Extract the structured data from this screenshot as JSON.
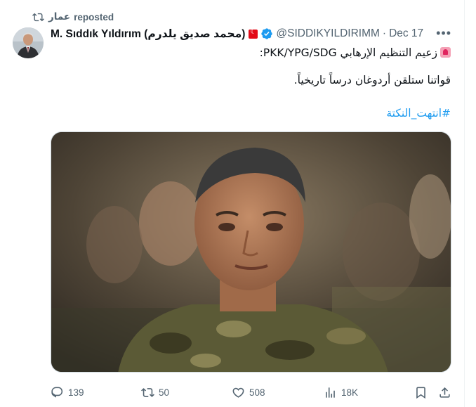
{
  "repost": {
    "user": "عمار",
    "label": "reposted"
  },
  "author": {
    "display_name": "M. Sıddık Yıldırım (محمد صديق يلدرم)",
    "handle": "@SIDDIKYILDIRIMM",
    "date": "Dec 17"
  },
  "tweet": {
    "line1": "زعيم التنظيم الإرهابي PKK/YPG/SDG:",
    "line2": "قواتنا ستلقن أردوغان درساً تاريخياً.",
    "hashtag": "#انتهت_النكتة"
  },
  "actions": {
    "replies": "139",
    "reposts": "50",
    "likes": "508",
    "views": "18K"
  },
  "colors": {
    "accent": "#1d9bf0",
    "muted": "#536471",
    "text": "#0f1419"
  },
  "icons": [
    "repost-icon",
    "verified-badge-icon",
    "more-icon",
    "reply-icon",
    "like-icon",
    "views-icon",
    "bookmark-icon",
    "share-icon",
    "siren-icon",
    "turkey-flag-icon"
  ]
}
